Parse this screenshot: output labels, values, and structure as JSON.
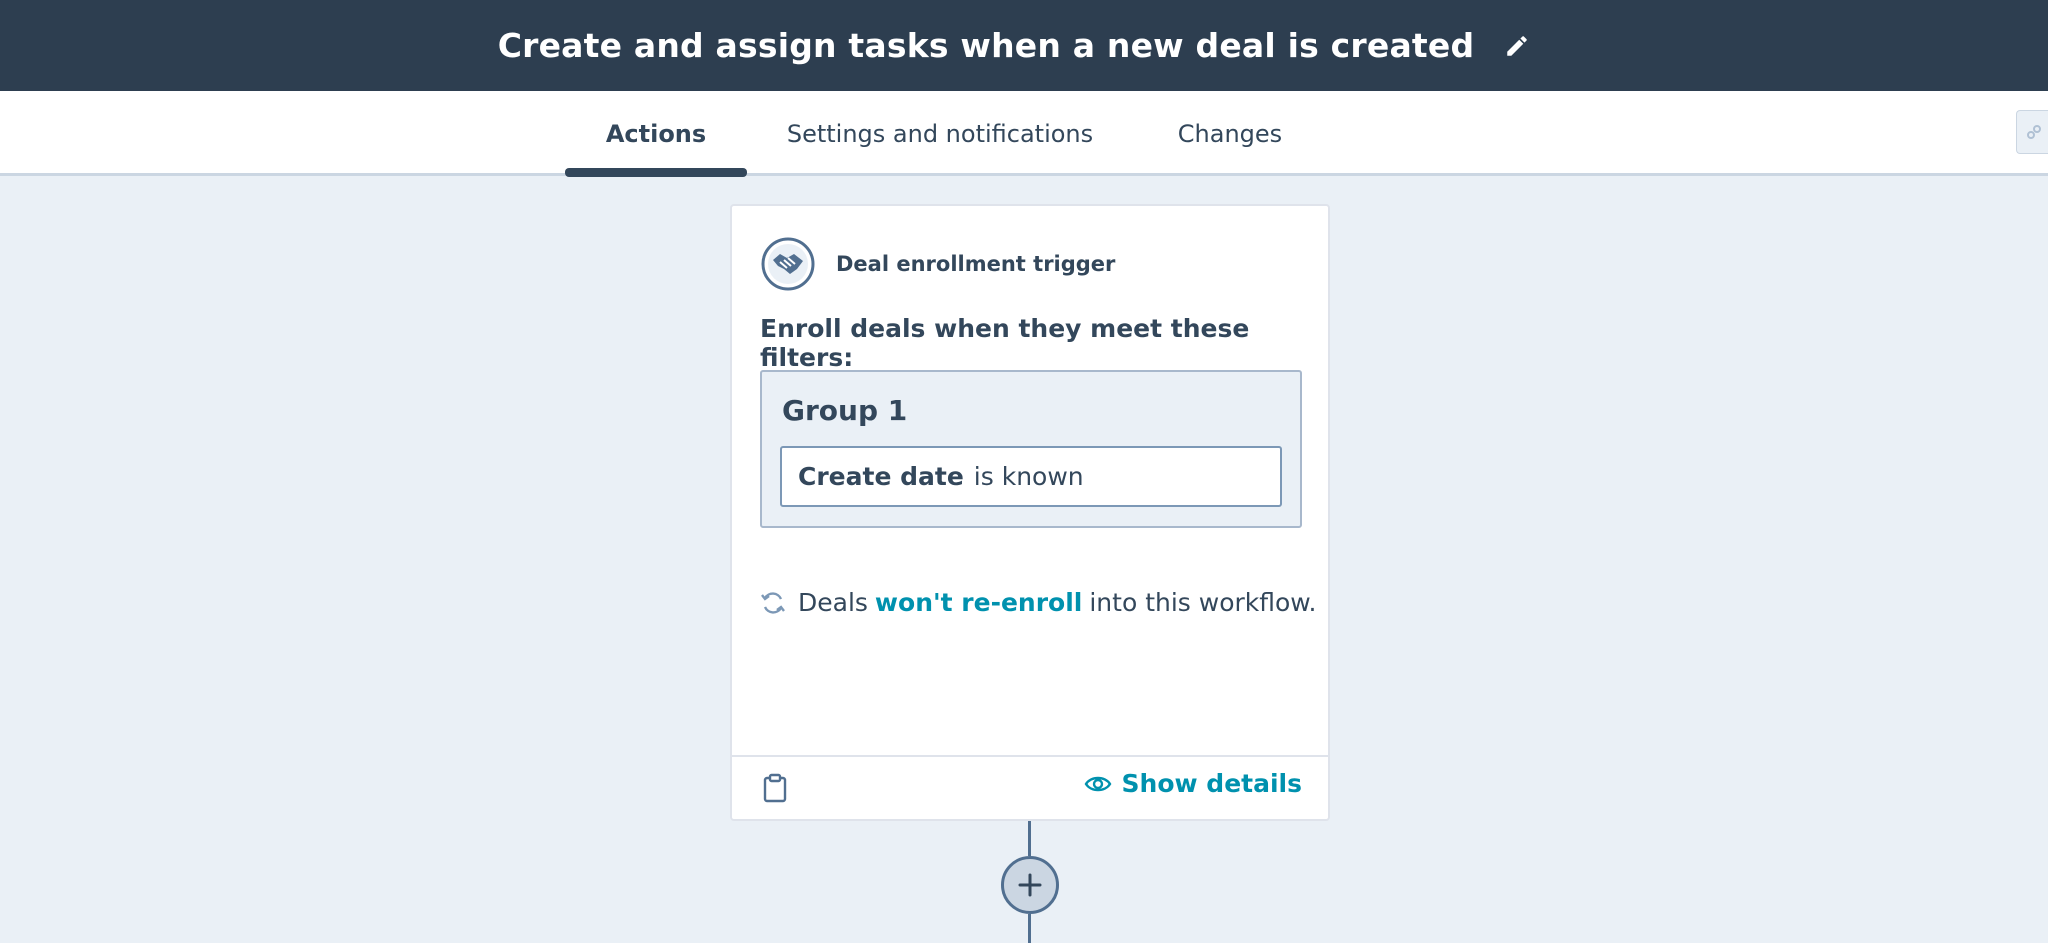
{
  "header": {
    "title": "Create and assign tasks when a new deal is created",
    "edit_icon": "pencil-icon"
  },
  "tabs": [
    {
      "label": "Actions",
      "active": true
    },
    {
      "label": "Settings and notifications",
      "active": false
    },
    {
      "label": "Changes",
      "active": false
    }
  ],
  "trigger_card": {
    "icon": "handshake-icon",
    "label": "Deal enrollment trigger",
    "enroll_text": "Enroll deals when they meet these filters:",
    "group": {
      "title": "Group 1",
      "filter": {
        "property": "Create date",
        "operator": "is known"
      }
    },
    "reenroll": {
      "icon": "sync-icon",
      "prefix": "Deals",
      "link": "won't re-enroll",
      "suffix": "into this workflow."
    },
    "footer": {
      "clipboard_icon": "clipboard-icon",
      "show_details_label": "Show details",
      "show_details_icon": "eye-icon"
    }
  },
  "add_action": {
    "icon": "plus-icon"
  },
  "colors": {
    "header_bg": "#2d3e50",
    "canvas_bg": "#eaf0f6",
    "text": "#33475b",
    "link": "#0091ae",
    "border": "#cbd6e2"
  }
}
